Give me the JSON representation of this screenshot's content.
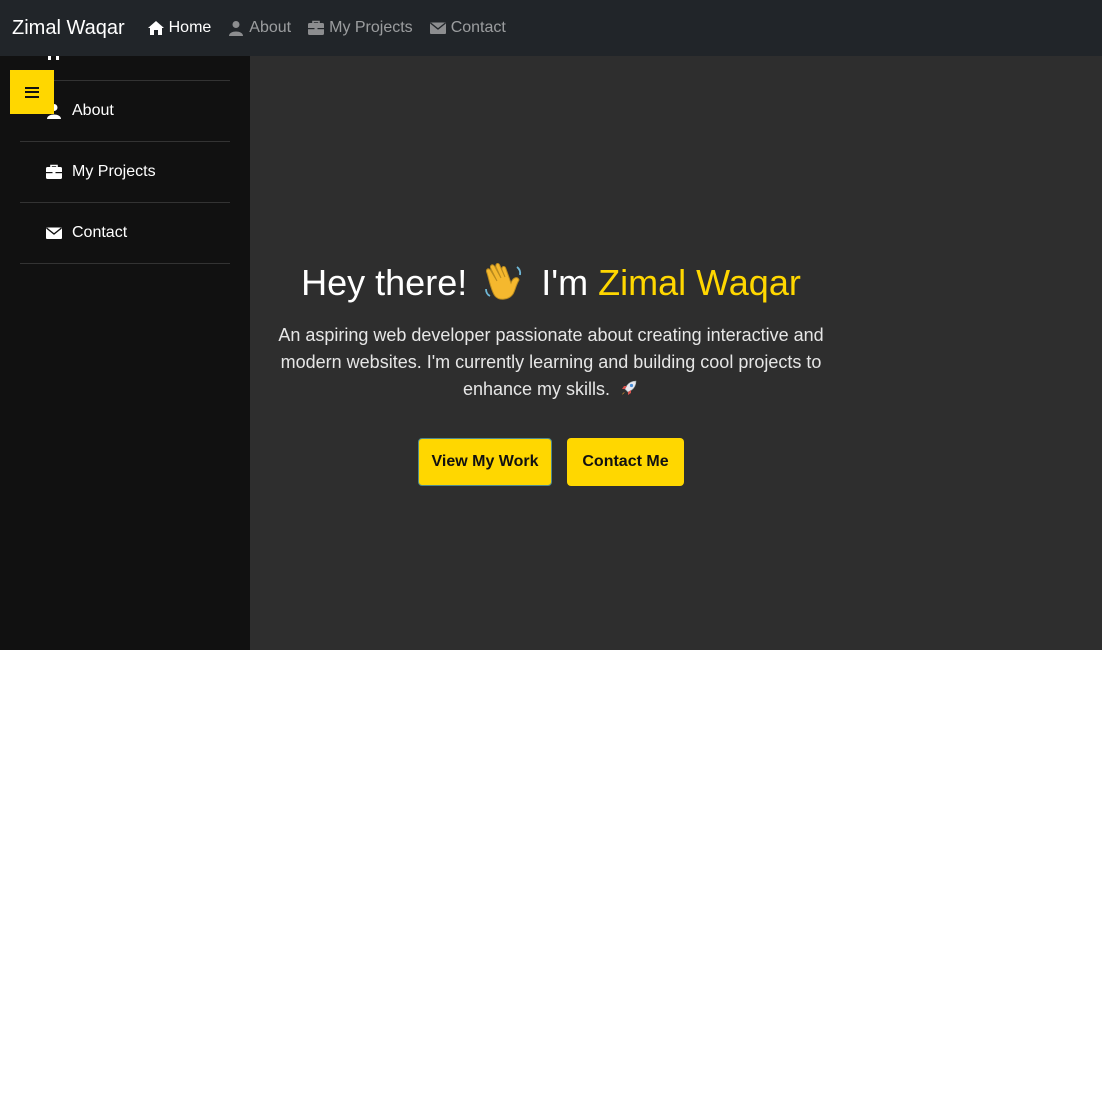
{
  "navbar": {
    "brand": "Zimal Waqar",
    "links": [
      {
        "label": "Home",
        "icon": "home-icon",
        "active": true
      },
      {
        "label": "About",
        "icon": "user-icon",
        "active": false
      },
      {
        "label": "My Projects",
        "icon": "briefcase-icon",
        "active": false
      },
      {
        "label": "Contact",
        "icon": "envelope-icon",
        "active": false
      }
    ]
  },
  "sidebar": {
    "toggle_icon": "hamburger-icon",
    "items": [
      {
        "label": "About",
        "icon": "user-icon"
      },
      {
        "label": "My Projects",
        "icon": "briefcase-icon"
      },
      {
        "label": "Contact",
        "icon": "envelope-icon"
      }
    ]
  },
  "hero": {
    "greeting": "Hey there!",
    "intro": "I'm",
    "name": "Zimal Waqar",
    "description": "An aspiring web developer passionate about creating interactive and modern websites. I'm currently learning and building cool projects to enhance my skills.",
    "buttons": {
      "view_work": "View My Work",
      "contact": "Contact Me"
    }
  },
  "colors": {
    "accent": "#ffd700",
    "navbar_bg": "#212529",
    "sidebar_bg": "#111111",
    "hero_bg": "#2e2e2e"
  }
}
